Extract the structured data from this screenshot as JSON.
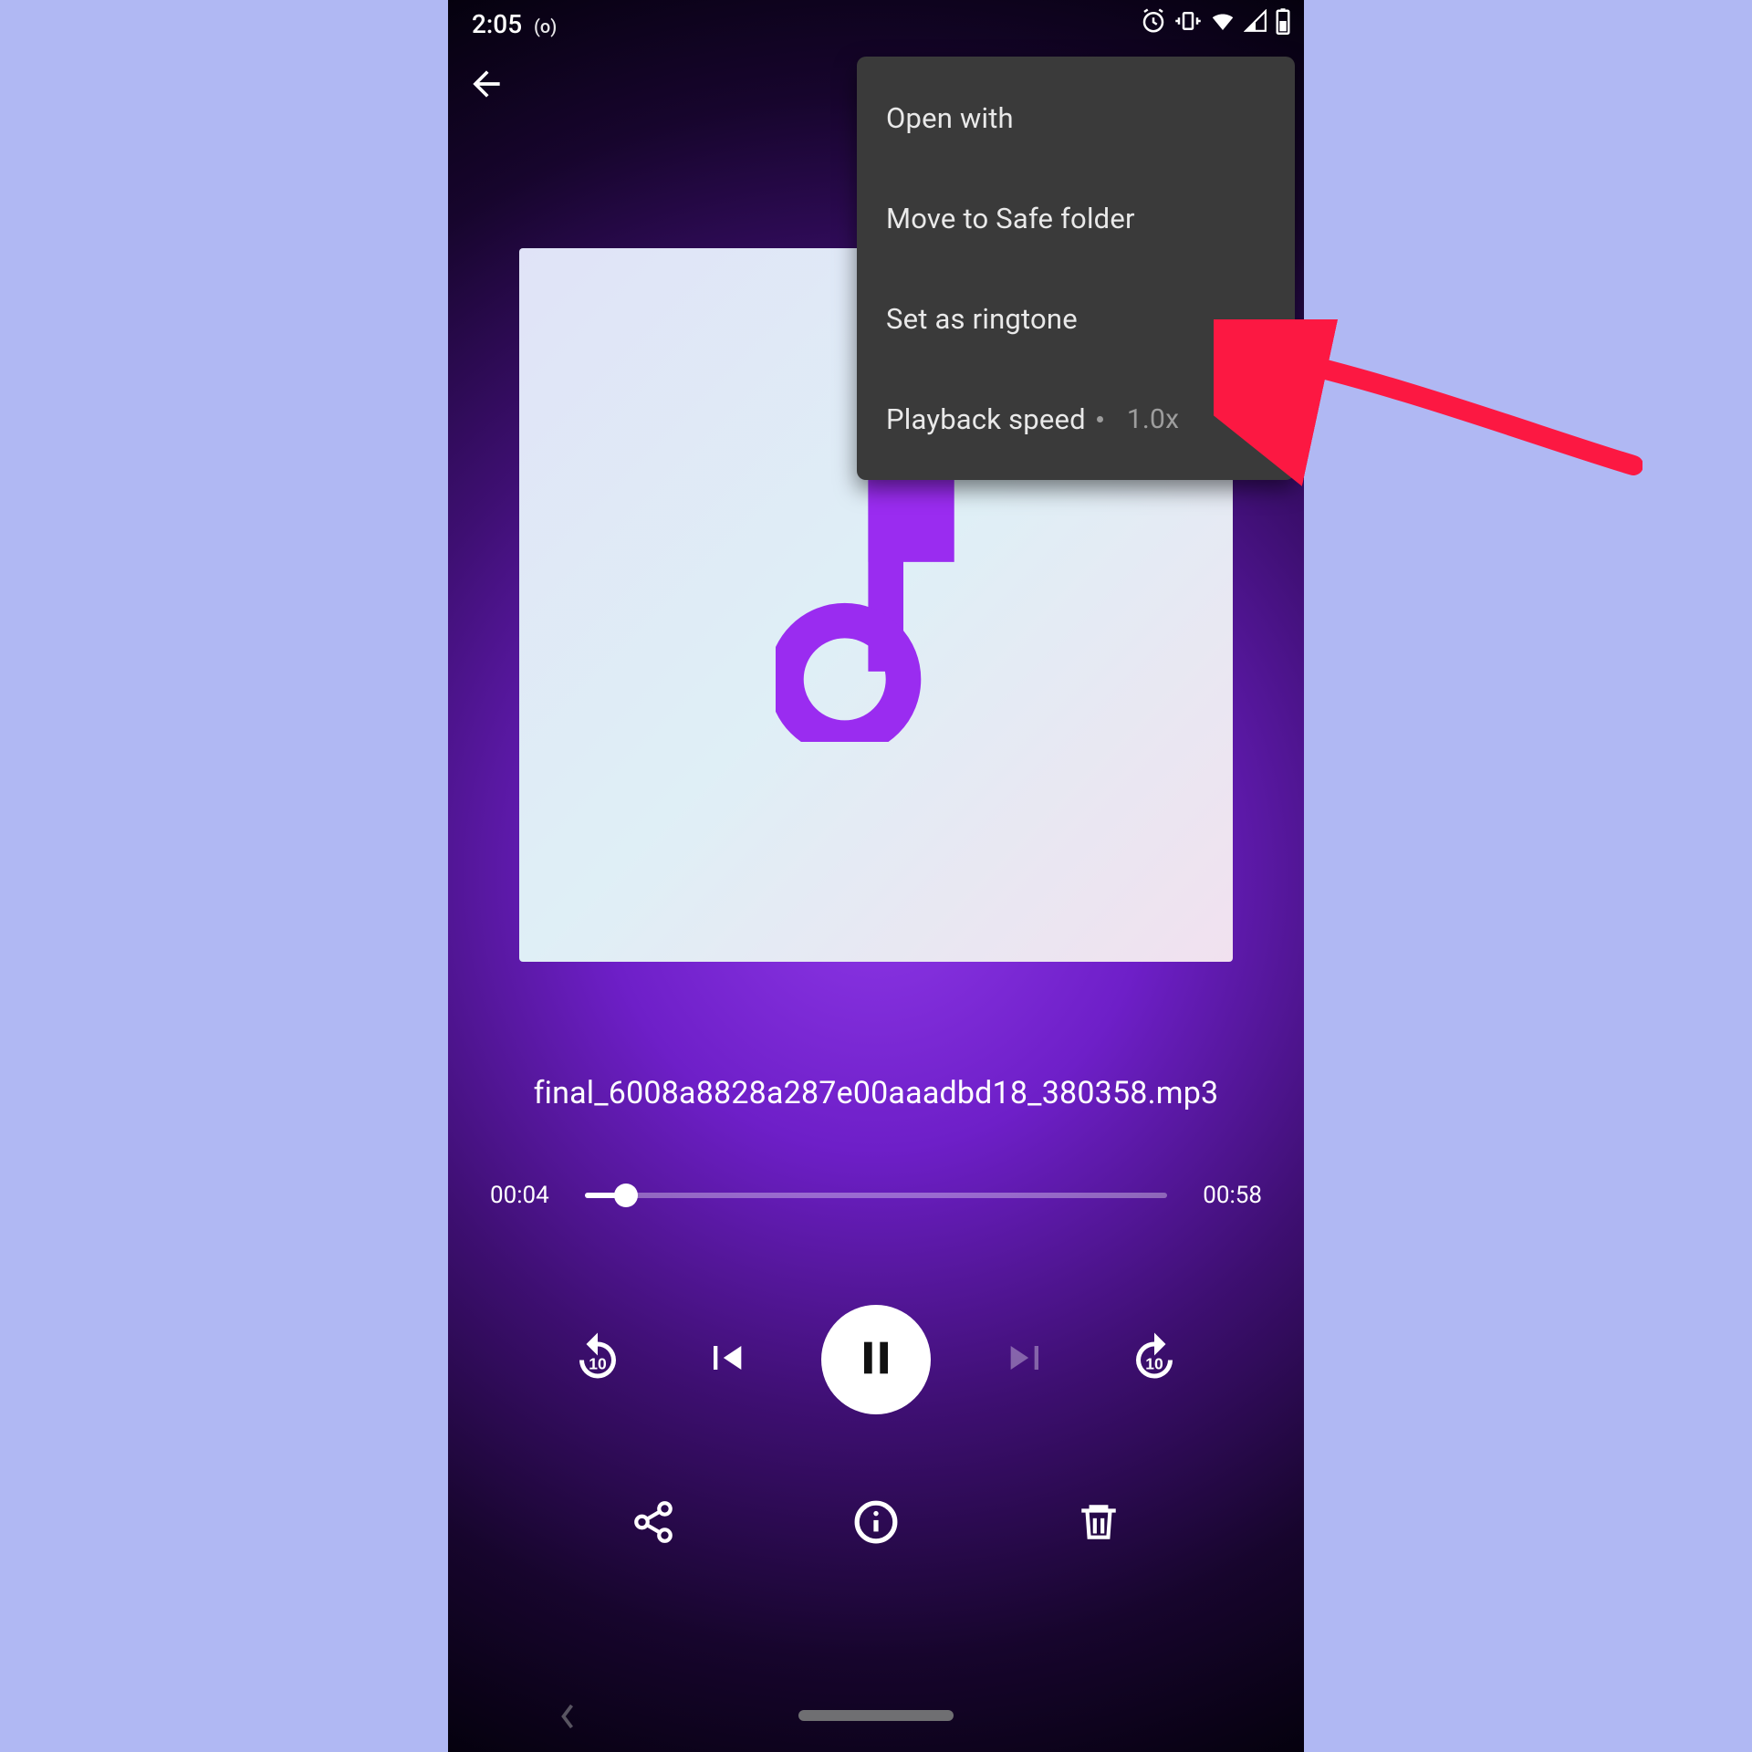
{
  "status_bar": {
    "time": "2:05",
    "recording_indicator": "(o)"
  },
  "popup_menu": {
    "items": [
      {
        "label": "Open with"
      },
      {
        "label": "Move to Safe folder"
      },
      {
        "label": "Set as ringtone"
      },
      {
        "label": "Playback speed",
        "suffix": "1.0x"
      }
    ],
    "highlighted_index": 2
  },
  "player": {
    "filename": "final_6008a8828a287e00aaadbd18_380358.mp3",
    "elapsed": "00:04",
    "total": "00:58",
    "progress_percent": 7
  },
  "colors": {
    "annotation_red": "#fc1842",
    "accent_purple": "#9a2cf0"
  },
  "icons": {
    "back": "arrow-back-icon",
    "alarm": "alarm-icon",
    "vibrate": "vibrate-icon",
    "wifi": "wifi-icon",
    "signal": "cell-signal-icon",
    "battery": "battery-icon",
    "music_note": "music-note-icon",
    "replay10": "replay-10-icon",
    "prev": "skip-previous-icon",
    "pause": "pause-icon",
    "next": "skip-next-icon",
    "forward10": "forward-10-icon",
    "share": "share-icon",
    "info": "info-icon",
    "delete": "trash-icon"
  }
}
